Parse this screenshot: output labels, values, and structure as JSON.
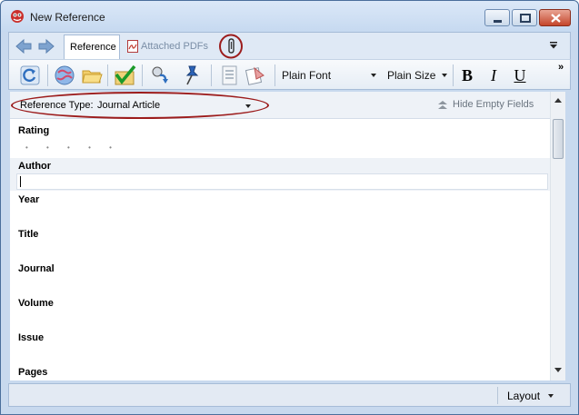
{
  "window": {
    "title": "New Reference",
    "controls": {
      "minimize": "minimize",
      "maximize": "maximize",
      "close": "close"
    }
  },
  "tabs": {
    "reference": "Reference",
    "attached_pdfs": "Attached PDFs"
  },
  "toolbar": {
    "font_value": "Plain Font",
    "size_value": "Plain Size",
    "bold": "B",
    "italic": "I",
    "underline": "U",
    "more": "»"
  },
  "reference_type": {
    "label": "Reference Type:",
    "value": "Journal Article",
    "hide_empty": "Hide Empty Fields"
  },
  "fields": {
    "rating": "Rating",
    "rating_stars": "• • • • •",
    "author": "Author",
    "year": "Year",
    "title": "Title",
    "journal": "Journal",
    "volume": "Volume",
    "issue": "Issue",
    "pages": "Pages"
  },
  "statusbar": {
    "layout": "Layout"
  },
  "colors": {
    "annotation": "#9c1c1c",
    "window_chrome": "#c8d9ee",
    "accent": "#4b6f9c"
  }
}
